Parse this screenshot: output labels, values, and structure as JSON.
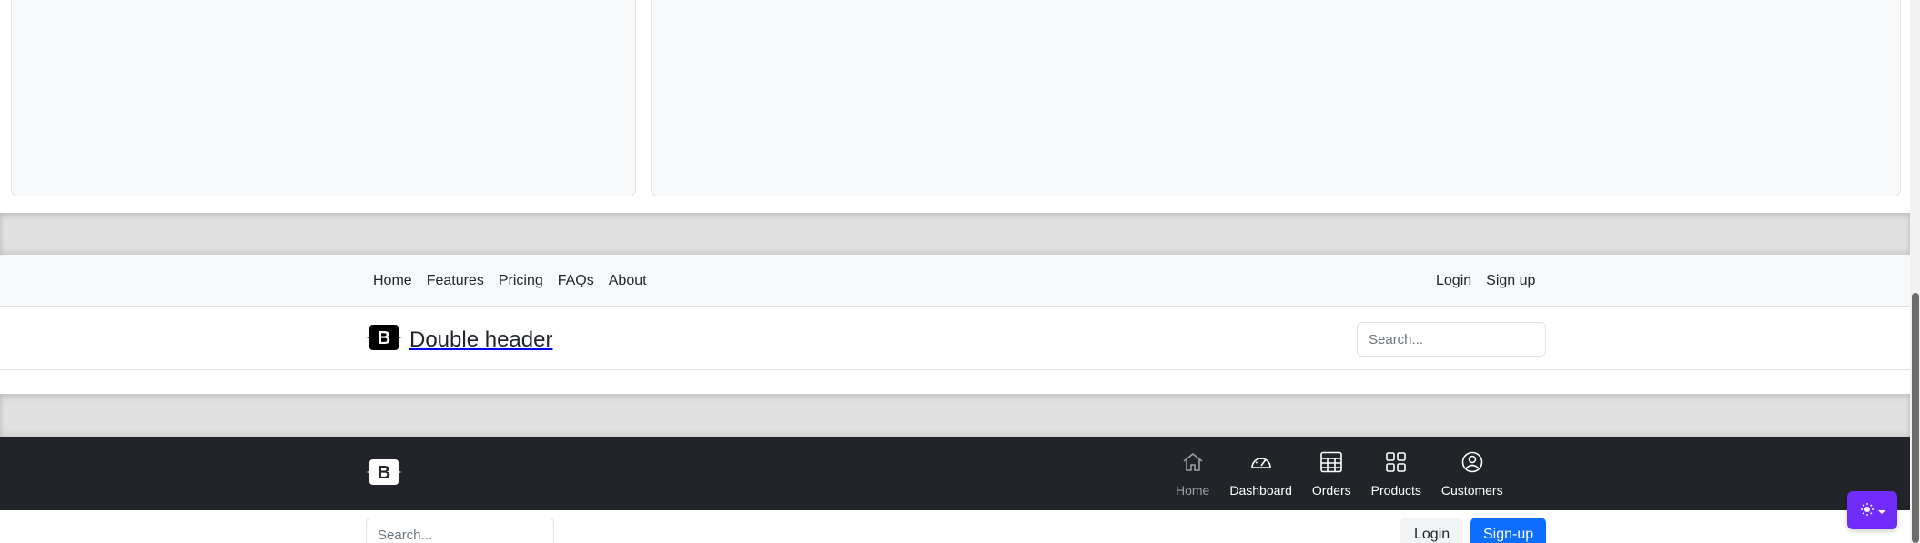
{
  "double_header": {
    "nav_items": [
      "Home",
      "Features",
      "Pricing",
      "FAQs",
      "About"
    ],
    "right_links": [
      "Login",
      "Sign up"
    ],
    "brand_title": "Double header",
    "search_placeholder": "Search..."
  },
  "dark_header": {
    "logo_icon": "bootstrap-logo-icon",
    "nav_items": [
      {
        "label": "Home",
        "icon": "house-icon",
        "muted": true
      },
      {
        "label": "Dashboard",
        "icon": "speedometer-icon",
        "muted": false
      },
      {
        "label": "Orders",
        "icon": "table-icon",
        "muted": false
      },
      {
        "label": "Products",
        "icon": "grid-icon",
        "muted": false
      },
      {
        "label": "Customers",
        "icon": "person-circle-icon",
        "muted": false
      }
    ]
  },
  "bottom_row": {
    "search_placeholder": "Search...",
    "login_label": "Login",
    "signup_label": "Sign-up"
  },
  "theme_toggle": {
    "icon": "sun-icon",
    "color": "#712cf9"
  },
  "colors": {
    "dark_bg": "#212529",
    "primary": "#0d6efd",
    "light_bg": "#f8f9fa"
  }
}
